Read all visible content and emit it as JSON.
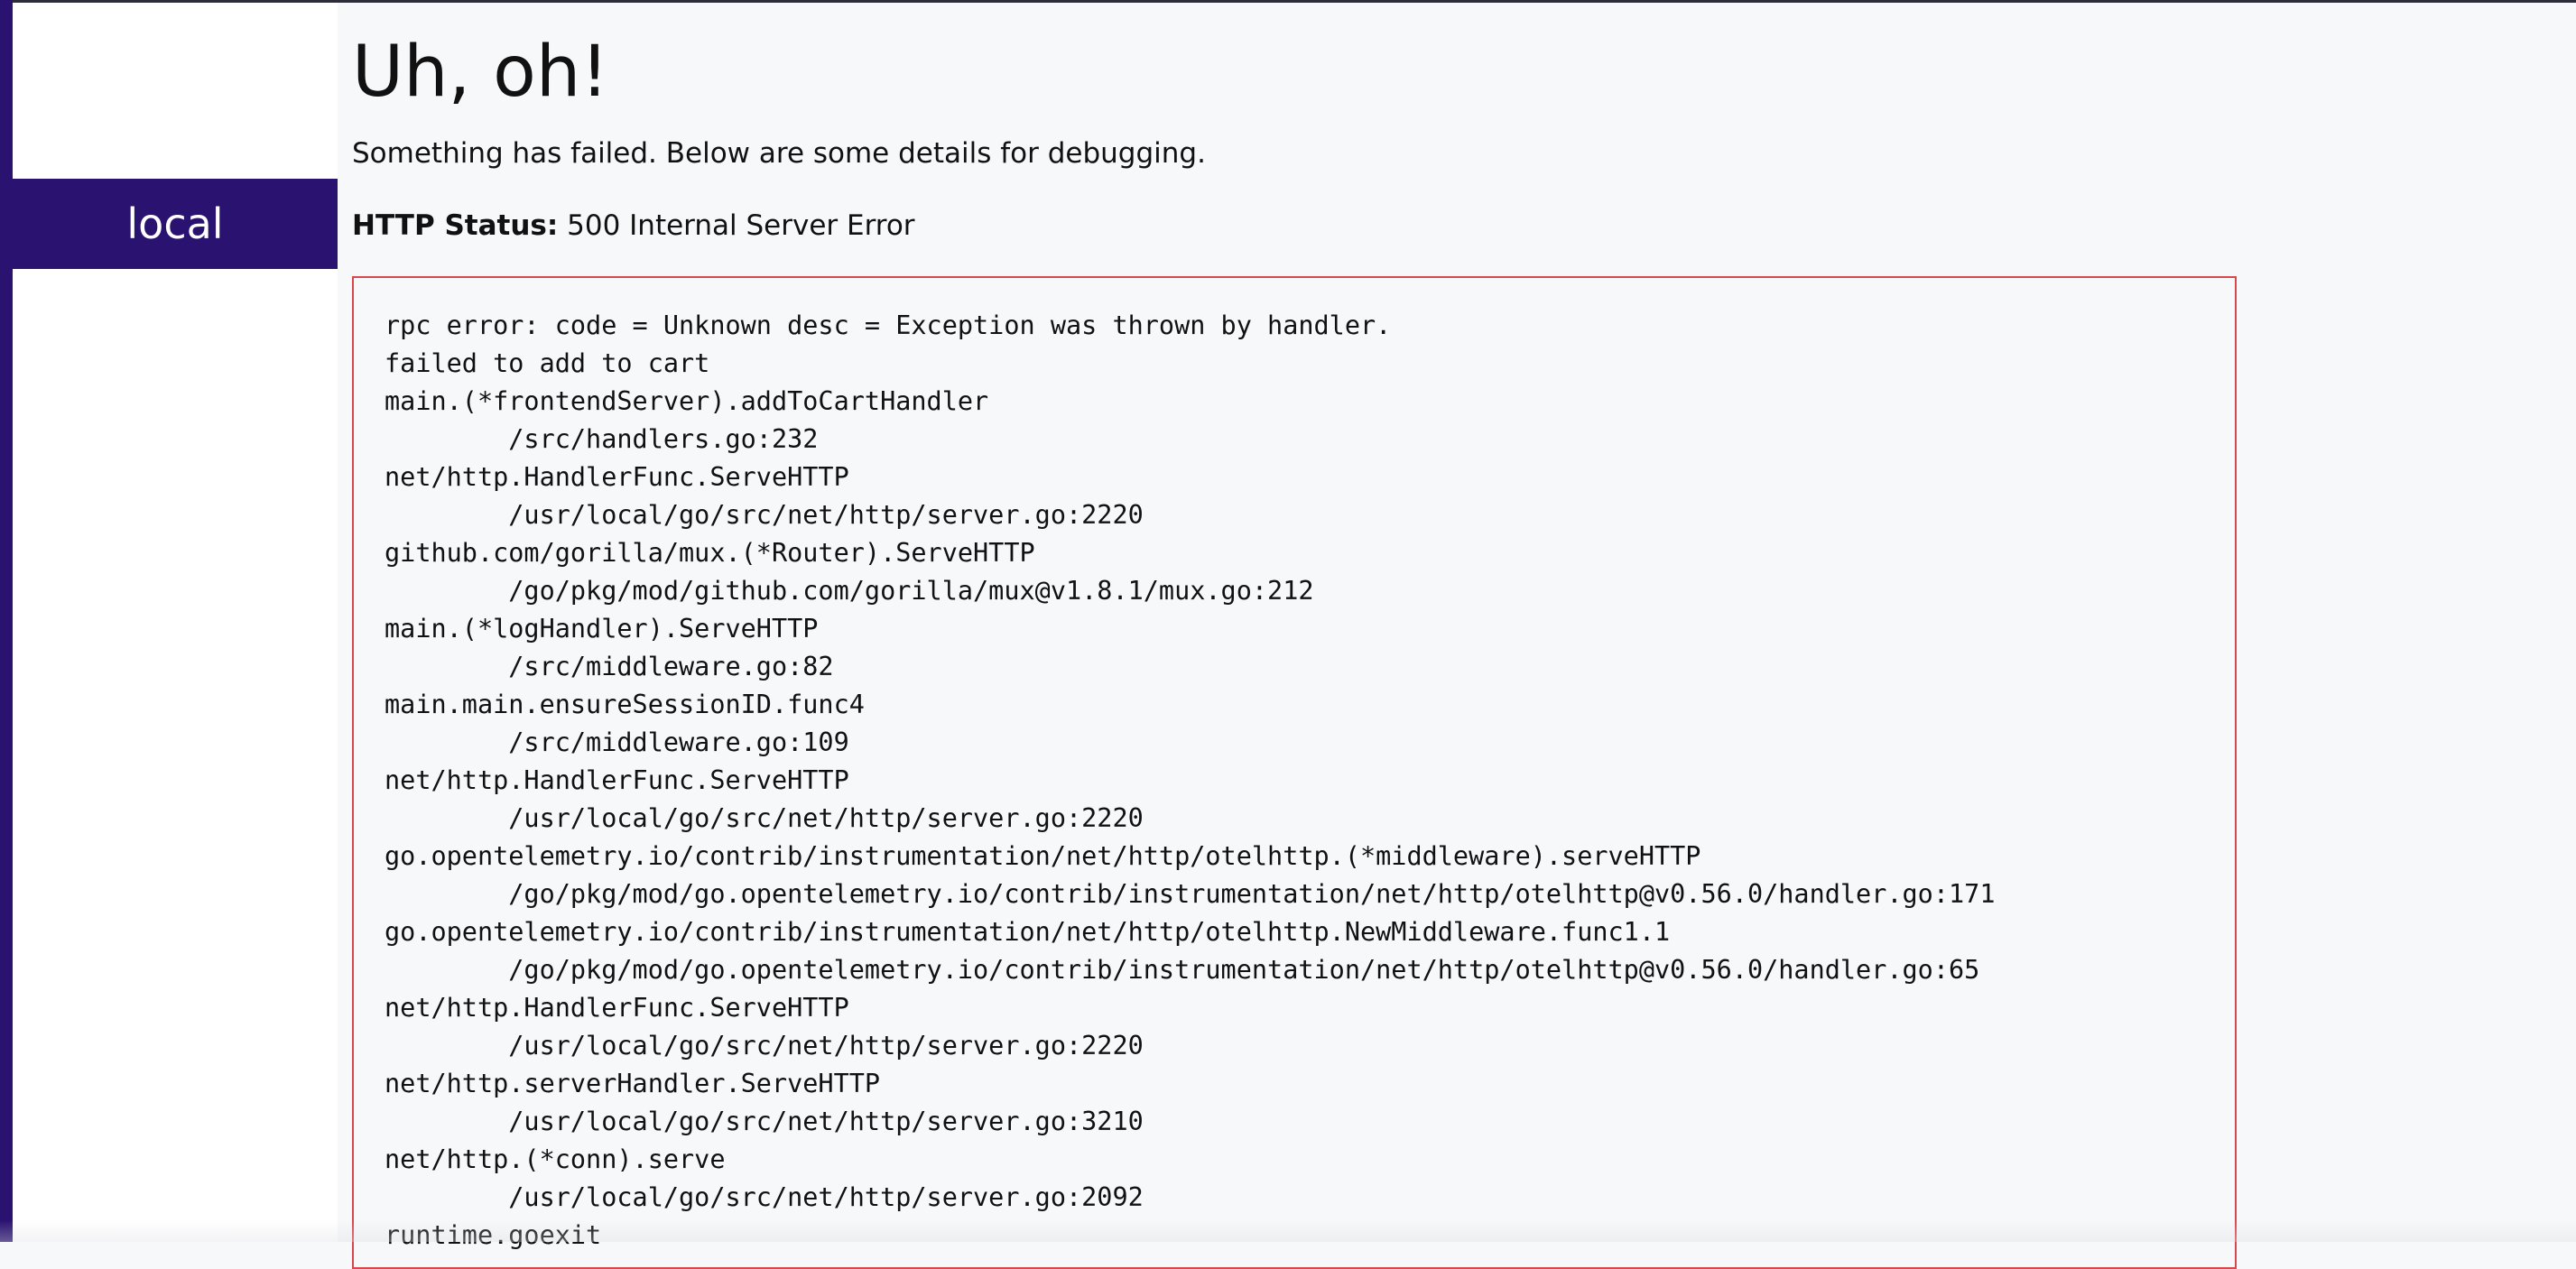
{
  "sidebar": {
    "environment_label": "local"
  },
  "error_page": {
    "heading": "Uh, oh!",
    "subtitle": "Something has failed. Below are some details for debugging.",
    "http_status_label": "HTTP Status:",
    "http_status_value": "500 Internal Server Error",
    "stack_trace": "rpc error: code = Unknown desc = Exception was thrown by handler.\nfailed to add to cart\nmain.(*frontendServer).addToCartHandler\n        /src/handlers.go:232\nnet/http.HandlerFunc.ServeHTTP\n        /usr/local/go/src/net/http/server.go:2220\ngithub.com/gorilla/mux.(*Router).ServeHTTP\n        /go/pkg/mod/github.com/gorilla/mux@v1.8.1/mux.go:212\nmain.(*logHandler).ServeHTTP\n        /src/middleware.go:82\nmain.main.ensureSessionID.func4\n        /src/middleware.go:109\nnet/http.HandlerFunc.ServeHTTP\n        /usr/local/go/src/net/http/server.go:2220\ngo.opentelemetry.io/contrib/instrumentation/net/http/otelhttp.(*middleware).serveHTTP\n        /go/pkg/mod/go.opentelemetry.io/contrib/instrumentation/net/http/otelhttp@v0.56.0/handler.go:171\ngo.opentelemetry.io/contrib/instrumentation/net/http/otelhttp.NewMiddleware.func1.1\n        /go/pkg/mod/go.opentelemetry.io/contrib/instrumentation/net/http/otelhttp@v0.56.0/handler.go:65\nnet/http.HandlerFunc.ServeHTTP\n        /usr/local/go/src/net/http/server.go:2220\nnet/http.serverHandler.ServeHTTP\n        /usr/local/go/src/net/http/server.go:3210\nnet/http.(*conn).serve\n        /usr/local/go/src/net/http/server.go:2092\nruntime.goexit"
  },
  "colors": {
    "brand_purple": "#2a1370",
    "error_border": "#d9474c",
    "page_background": "#f7f8fa"
  }
}
